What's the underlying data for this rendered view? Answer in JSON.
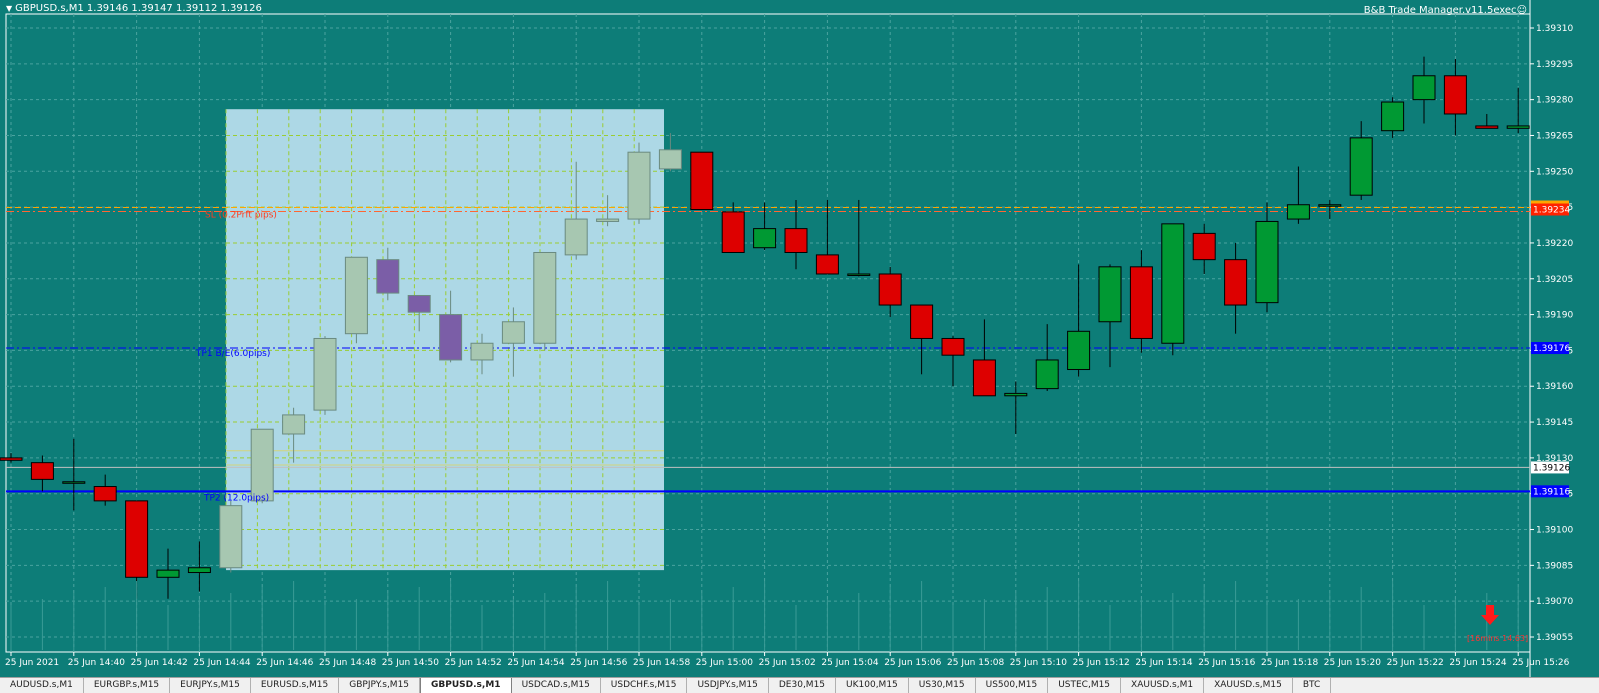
{
  "chart": {
    "symbol_header": "GBPUSD.s,M1  1.39146 1.39147 1.39112 1.39126",
    "ea_label": "B&B Trade Manager.v11.5exec",
    "smiley": "☺",
    "arrow_note": "[16mins 14.63]"
  },
  "colors": {
    "background": "#0d7d78",
    "grid": "#4aa39f",
    "bull": "#009933",
    "bear": "#dd0000",
    "box_fill": "#add8e6",
    "box_grid": "#9acd32",
    "bull_in_box": "#a7c7b1",
    "bear_in_box": "#7b5ea7",
    "blue_line": "#0000ff",
    "sl_line": "#ff6633",
    "orange_line": "#ffa500"
  },
  "lines": {
    "sl_label": "SL (0.2Prft pips)",
    "tp1_label": "TP1 B/E(6.0pips)",
    "tp2_label": "TP2 (12.0pips)",
    "sl_price_tag": "1.39234",
    "tp1_price_tag": "1.39176",
    "tp2_price_tag": "1.39116",
    "bid_tag": "1.39126"
  },
  "chart_data": {
    "type": "candlestick",
    "price_ticks": [
      "1.39310",
      "1.39295",
      "1.39280",
      "1.39265",
      "1.39250",
      "1.39235",
      "1.39220",
      "1.39205",
      "1.39190",
      "1.39175",
      "1.39160",
      "1.39145",
      "1.39130",
      "1.39115",
      "1.39100",
      "1.39085",
      "1.39070",
      "1.39055"
    ],
    "time_labels": [
      "25 Jun 2021",
      "25 Jun 14:40",
      "25 Jun 14:42",
      "25 Jun 14:44",
      "25 Jun 14:46",
      "25 Jun 14:48",
      "25 Jun 14:50",
      "25 Jun 14:52",
      "25 Jun 14:54",
      "25 Jun 14:56",
      "25 Jun 14:58",
      "25 Jun 15:00",
      "25 Jun 15:02",
      "25 Jun 15:04",
      "25 Jun 15:06",
      "25 Jun 15:08",
      "25 Jun 15:10",
      "25 Jun 15:12",
      "25 Jun 15:14",
      "25 Jun 15:16",
      "25 Jun 15:18",
      "25 Jun 15:20",
      "25 Jun 15:22",
      "25 Jun 15:24",
      "25 Jun 15:26"
    ],
    "levels": {
      "sl": 1.39234,
      "tp1": 1.39176,
      "tp2": 1.39116,
      "bid": 1.39126
    },
    "candles": [
      {
        "o": 1.3913,
        "h": 1.39132,
        "l": 1.39128,
        "c": 1.39129
      },
      {
        "o": 1.39128,
        "h": 1.39131,
        "l": 1.39116,
        "c": 1.39121
      },
      {
        "o": 1.3912,
        "h": 1.39138,
        "l": 1.39108,
        "c": 1.3912
      },
      {
        "o": 1.39118,
        "h": 1.39123,
        "l": 1.3911,
        "c": 1.39112
      },
      {
        "o": 1.39112,
        "h": 1.39112,
        "l": 1.39071,
        "c": 1.3908
      },
      {
        "o": 1.3908,
        "h": 1.39092,
        "l": 1.39071,
        "c": 1.39083
      },
      {
        "o": 1.39082,
        "h": 1.39095,
        "l": 1.39074,
        "c": 1.39084
      },
      {
        "o": 1.39084,
        "h": 1.39112,
        "l": 1.39082,
        "c": 1.3911
      },
      {
        "o": 1.39112,
        "h": 1.39142,
        "l": 1.39111,
        "c": 1.39142
      },
      {
        "o": 1.3914,
        "h": 1.39151,
        "l": 1.39128,
        "c": 1.39148
      },
      {
        "o": 1.3915,
        "h": 1.39181,
        "l": 1.39148,
        "c": 1.3918
      },
      {
        "o": 1.39182,
        "h": 1.39214,
        "l": 1.39178,
        "c": 1.39214
      },
      {
        "o": 1.39213,
        "h": 1.39218,
        "l": 1.39196,
        "c": 1.39199
      },
      {
        "o": 1.39198,
        "h": 1.39198,
        "l": 1.39183,
        "c": 1.39191
      },
      {
        "o": 1.3919,
        "h": 1.392,
        "l": 1.3917,
        "c": 1.39171
      },
      {
        "o": 1.39171,
        "h": 1.39182,
        "l": 1.39165,
        "c": 1.39178
      },
      {
        "o": 1.39178,
        "h": 1.39193,
        "l": 1.39164,
        "c": 1.39187
      },
      {
        "o": 1.39178,
        "h": 1.39216,
        "l": 1.39175,
        "c": 1.39216
      },
      {
        "o": 1.39215,
        "h": 1.39254,
        "l": 1.39213,
        "c": 1.3923
      },
      {
        "o": 1.39229,
        "h": 1.3924,
        "l": 1.39227,
        "c": 1.3923
      },
      {
        "o": 1.3923,
        "h": 1.39262,
        "l": 1.39228,
        "c": 1.39258
      },
      {
        "o": 1.39251,
        "h": 1.39266,
        "l": 1.3925,
        "c": 1.39259
      },
      {
        "o": 1.39258,
        "h": 1.39258,
        "l": 1.39234,
        "c": 1.39234
      },
      {
        "o": 1.39233,
        "h": 1.39237,
        "l": 1.39216,
        "c": 1.39216
      },
      {
        "o": 1.39218,
        "h": 1.39237,
        "l": 1.39217,
        "c": 1.39226
      },
      {
        "o": 1.39226,
        "h": 1.39238,
        "l": 1.39209,
        "c": 1.39216
      },
      {
        "o": 1.39215,
        "h": 1.39238,
        "l": 1.39208,
        "c": 1.39207
      },
      {
        "o": 1.39207,
        "h": 1.39238,
        "l": 1.39206,
        "c": 1.39207
      },
      {
        "o": 1.39207,
        "h": 1.3921,
        "l": 1.39189,
        "c": 1.39194
      },
      {
        "o": 1.39194,
        "h": 1.39194,
        "l": 1.39165,
        "c": 1.3918
      },
      {
        "o": 1.3918,
        "h": 1.39181,
        "l": 1.3916,
        "c": 1.39173
      },
      {
        "o": 1.39171,
        "h": 1.39188,
        "l": 1.39156,
        "c": 1.39156
      },
      {
        "o": 1.39156,
        "h": 1.39162,
        "l": 1.3914,
        "c": 1.39157
      },
      {
        "o": 1.39159,
        "h": 1.39186,
        "l": 1.39158,
        "c": 1.39171
      },
      {
        "o": 1.39167,
        "h": 1.39211,
        "l": 1.39164,
        "c": 1.39183
      },
      {
        "o": 1.39187,
        "h": 1.39211,
        "l": 1.39168,
        "c": 1.3921
      },
      {
        "o": 1.3921,
        "h": 1.39217,
        "l": 1.39174,
        "c": 1.3918
      },
      {
        "o": 1.39178,
        "h": 1.39228,
        "l": 1.39173,
        "c": 1.39228
      },
      {
        "o": 1.39224,
        "h": 1.39228,
        "l": 1.39207,
        "c": 1.39213
      },
      {
        "o": 1.39213,
        "h": 1.3922,
        "l": 1.39182,
        "c": 1.39194
      },
      {
        "o": 1.39195,
        "h": 1.39237,
        "l": 1.39191,
        "c": 1.39229
      },
      {
        "o": 1.3923,
        "h": 1.39252,
        "l": 1.39228,
        "c": 1.39236
      },
      {
        "o": 1.39236,
        "h": 1.39238,
        "l": 1.3923,
        "c": 1.39236
      },
      {
        "o": 1.3924,
        "h": 1.39271,
        "l": 1.39238,
        "c": 1.39264
      },
      {
        "o": 1.39267,
        "h": 1.39281,
        "l": 1.39264,
        "c": 1.39279
      },
      {
        "o": 1.3928,
        "h": 1.39298,
        "l": 1.3927,
        "c": 1.3929
      },
      {
        "o": 1.3929,
        "h": 1.39297,
        "l": 1.39265,
        "c": 1.39274
      },
      {
        "o": 1.39269,
        "h": 1.39274,
        "l": 1.39269,
        "c": 1.39268
      },
      {
        "o": 1.39268,
        "h": 1.39285,
        "l": 1.39266,
        "c": 1.39269
      }
    ]
  },
  "tabs": [
    "AUDUSD.s,M1",
    "EURGBP.s,M15",
    "EURJPY.s,M15",
    "EURUSD.s,M15",
    "GBPJPY.s,M15",
    "GBPUSD.s,M1",
    "USDCAD.s,M15",
    "USDCHF.s,M15",
    "USDJPY.s,M15",
    "DE30,M15",
    "UK100,M15",
    "US30,M15",
    "US500,M15",
    "USTEC,M15",
    "XAUUSD.s,M1",
    "XAUUSD.s,M15",
    "BTC"
  ],
  "active_tab_index": 5
}
